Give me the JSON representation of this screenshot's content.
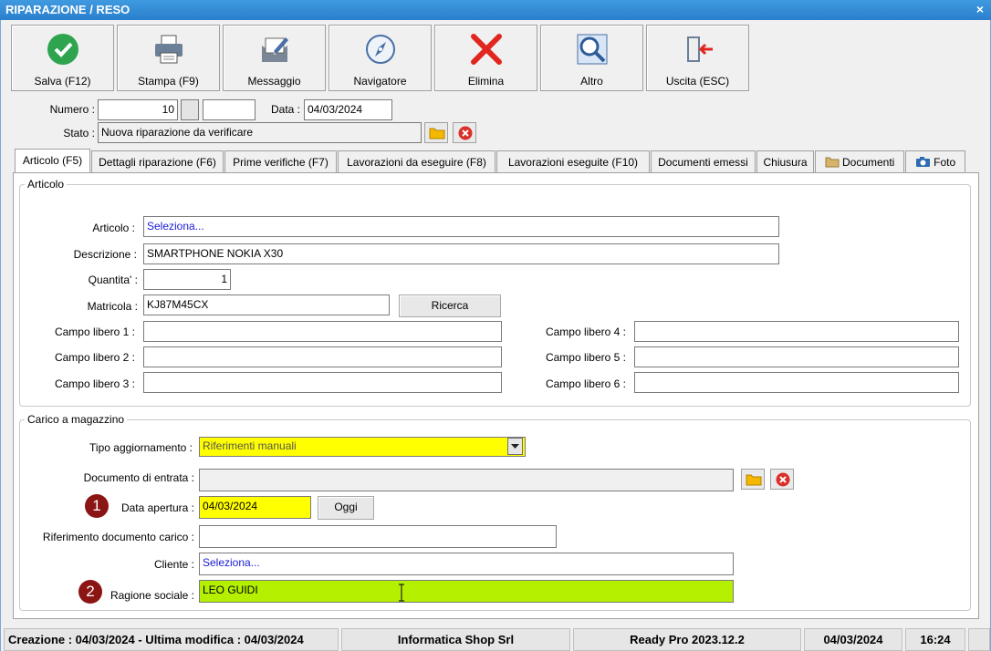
{
  "window": {
    "title": "RIPARAZIONE / RESO",
    "close": "×"
  },
  "toolbar": {
    "buttons": [
      {
        "label": "Salva (F12)",
        "icon": "check-circle-icon"
      },
      {
        "label": "Stampa (F9)",
        "icon": "printer-icon"
      },
      {
        "label": "Messaggio",
        "icon": "message-icon"
      },
      {
        "label": "Navigatore",
        "icon": "compass-icon"
      },
      {
        "label": "Elimina",
        "icon": "delete-x-icon"
      },
      {
        "label": "Altro",
        "icon": "search-icon"
      },
      {
        "label": "Uscita (ESC)",
        "icon": "exit-door-icon"
      }
    ]
  },
  "header": {
    "numero_label": "Numero :",
    "numero_value": "10",
    "data_label": "Data :",
    "data_value": "04/03/2024",
    "stato_label": "Stato :",
    "stato_value": "Nuova riparazione da verificare"
  },
  "tabs": [
    {
      "label": "Articolo (F5)"
    },
    {
      "label": "Dettagli riparazione (F6)"
    },
    {
      "label": "Prime verifiche (F7)"
    },
    {
      "label": "Lavorazioni da eseguire (F8)"
    },
    {
      "label": "Lavorazioni eseguite  (F10)"
    },
    {
      "label": "Documenti emessi"
    },
    {
      "label": "Chiusura"
    },
    {
      "label": "Documenti"
    },
    {
      "label": "Foto"
    }
  ],
  "articolo": {
    "group_title": "Articolo",
    "articolo_label": "Articolo :",
    "articolo_value": "Seleziona...",
    "descrizione_label": "Descrizione :",
    "descrizione_value": "SMARTPHONE NOKIA X30",
    "quantita_label": "Quantita' :",
    "quantita_value": "1",
    "matricola_label": "Matricola :",
    "matricola_value": "KJ87M45CX",
    "ricerca_label": "Ricerca",
    "campi": [
      {
        "label": "Campo libero 1 :",
        "value": ""
      },
      {
        "label": "Campo libero 2 :",
        "value": ""
      },
      {
        "label": "Campo libero 3 :",
        "value": ""
      },
      {
        "label": "Campo libero 4 :",
        "value": ""
      },
      {
        "label": "Campo libero 5 :",
        "value": ""
      },
      {
        "label": "Campo libero 6 :",
        "value": ""
      }
    ]
  },
  "carico": {
    "group_title": "Carico a magazzino",
    "tipo_label": "Tipo aggiornamento :",
    "tipo_value": "Riferimenti manuali",
    "documento_label": "Documento di entrata :",
    "documento_value": "",
    "apertura_label": "Data apertura :",
    "apertura_value": "04/03/2024",
    "oggi_label": "Oggi",
    "riferimento_label": "Riferimento documento carico :",
    "riferimento_value": "",
    "cliente_label": "Cliente :",
    "cliente_value": "Seleziona...",
    "ragione_label": "Ragione sociale :",
    "ragione_value": "LEO GUIDI"
  },
  "badges": {
    "one": "1",
    "two": "2"
  },
  "statusbar": {
    "creazione": "Creazione : 04/03/2024 - Ultima modifica : 04/03/2024",
    "company": "Informatica Shop Srl",
    "version": "Ready Pro 2023.12.2",
    "date": "04/03/2024",
    "time": "16:24"
  },
  "colors": {
    "titlebar": "#2a7fcc",
    "highlight_yellow": "#ffff00",
    "highlight_green": "#b4f000",
    "badge": "#8b1414",
    "link": "#1a1ad6"
  }
}
